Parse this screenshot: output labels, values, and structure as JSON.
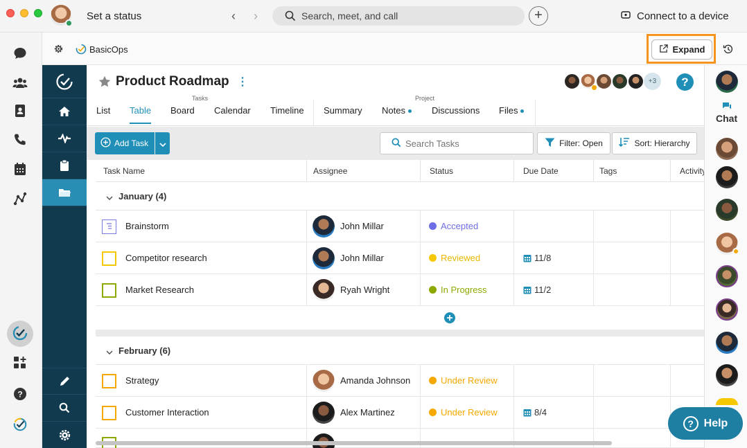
{
  "titlebar": {
    "status_label": "Set a status",
    "search_placeholder": "Search, meet, and call",
    "connect_label": "Connect to a device"
  },
  "plugin": {
    "name": "BasicOps",
    "expand_label": "Expand"
  },
  "project": {
    "title": "Product Roadmap",
    "members_more": "+3",
    "help_q": "?"
  },
  "tab_groups": {
    "tasks": "Tasks",
    "project": "Project"
  },
  "tabs": [
    {
      "label": "List"
    },
    {
      "label": "Table",
      "active": true
    },
    {
      "label": "Board"
    },
    {
      "label": "Calendar"
    },
    {
      "label": "Timeline"
    },
    {
      "label": "Summary"
    },
    {
      "label": "Notes",
      "dot": true
    },
    {
      "label": "Discussions"
    },
    {
      "label": "Files",
      "dot": true
    }
  ],
  "toolbar": {
    "add_task": "Add Task",
    "search_placeholder": "Search Tasks",
    "filter": "Filter: Open",
    "sort": "Sort: Hierarchy"
  },
  "columns": [
    "Task Name",
    "Assignee",
    "Status",
    "Due Date",
    "Tags",
    "Activity"
  ],
  "groups": [
    {
      "title": "January (4)",
      "rows": [
        {
          "name": "Brainstorm",
          "assignee": "John Millar",
          "status": "Accepted",
          "status_color": "#6e6ee6",
          "due": "",
          "icon": "note-task-icon"
        },
        {
          "name": "Competitor research",
          "assignee": "John Millar",
          "status": "Reviewed",
          "status_color": "#f5c800",
          "due": "11/8"
        },
        {
          "name": "Market Research",
          "assignee": "Ryah Wright",
          "status": "In Progress",
          "status_color": "#8fa800",
          "due": "11/2"
        }
      ]
    },
    {
      "title": "February (6)",
      "rows": [
        {
          "name": "Strategy",
          "assignee": "Amanda Johnson",
          "status": "Under Review",
          "status_color": "#f5a800",
          "due": ""
        },
        {
          "name": "Customer Interaction",
          "assignee": "Alex Martinez",
          "status": "Under Review",
          "status_color": "#f5a800",
          "due": "8/4"
        }
      ]
    }
  ],
  "chat_label": "Chat",
  "help_label": "Help",
  "colors": {
    "accent": "#1f8fb8",
    "sidebar": "#123a4f",
    "highlight": "#f7941d"
  }
}
